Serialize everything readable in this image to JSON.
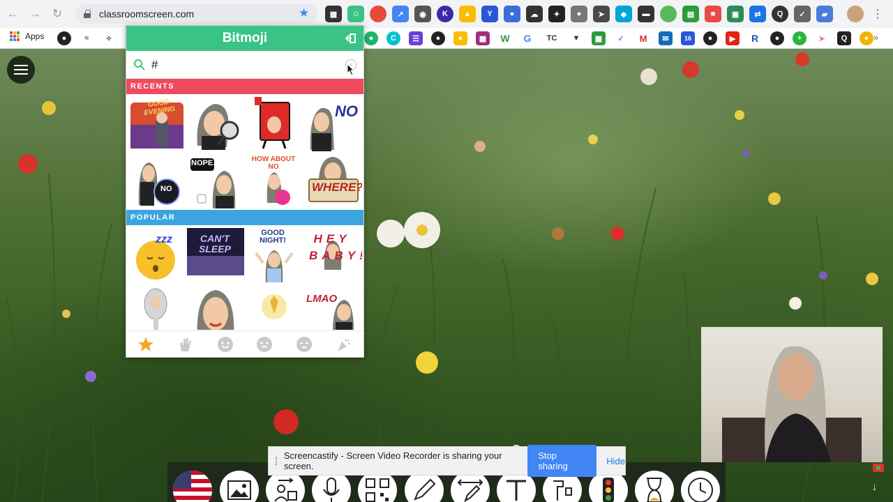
{
  "browser": {
    "url": "classroomscreen.com",
    "bookmarks_apps_label": "Apps",
    "bookmark_tc_label": "TC",
    "extension_k_label": "K",
    "extension_y_label": "Y",
    "bookmark_w_label": "W",
    "bookmark_g_label": "G",
    "bookmark_m_label": "M",
    "bookmark_16_label": "16",
    "bookmark_r_label": "R"
  },
  "bitmoji": {
    "title": "Bitmoji",
    "search_value": "#",
    "recents_label": "RECENTS",
    "popular_label": "POPULAR",
    "stickers": {
      "good_evening": "GOOD EVENING",
      "no": "NO",
      "nope": "NOPE.",
      "how_about_no": "HOW ABOUT NO",
      "no_ball": "NO",
      "where": "WHERE?",
      "zzz": "zzz",
      "cant_sleep": "CAN'T SLEEP",
      "good_night": "GOOD NIGHT!",
      "hey_baby": "HEY BABY!",
      "lmao": "LMAO"
    }
  },
  "screencastify": {
    "message": "Screencastify - Screen Video Recorder is sharing your screen.",
    "stop_label": "Stop sharing",
    "hide_label": "Hide"
  },
  "colors": {
    "bitmoji_green": "#39c486",
    "recents_red": "#ef4a5f",
    "popular_blue": "#3ca5e0",
    "stop_blue": "#4285f4"
  }
}
